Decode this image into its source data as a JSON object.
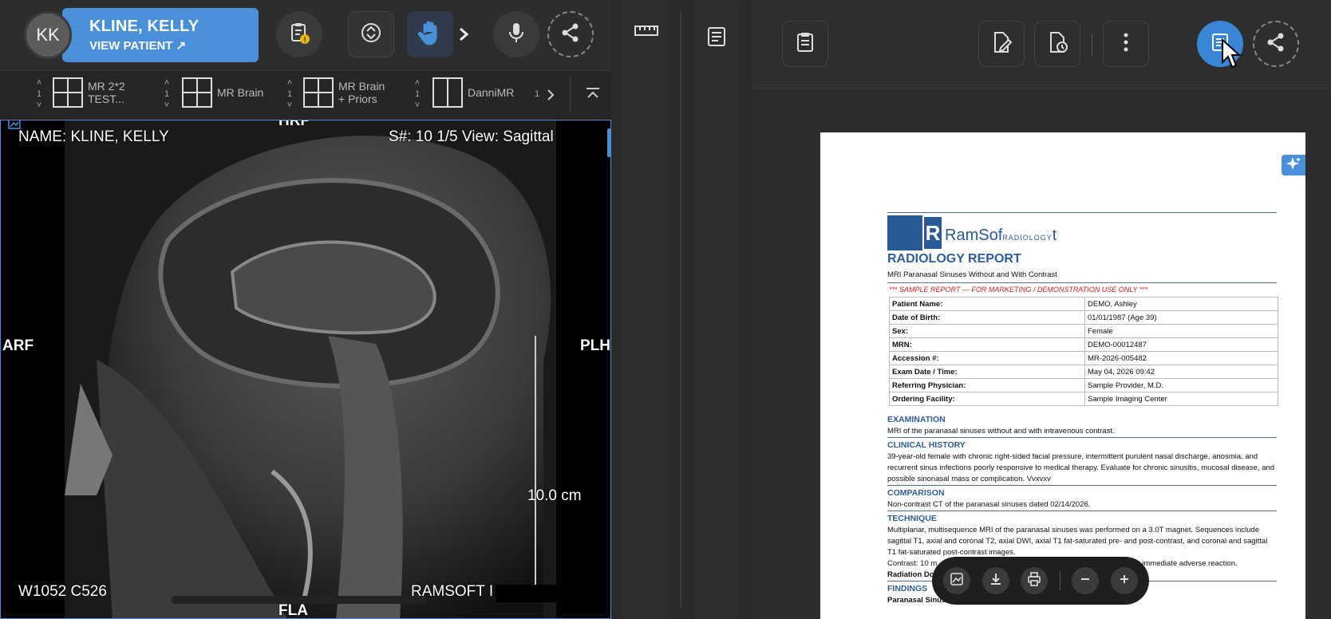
{
  "patient": {
    "initials": "KK",
    "name": "KLINE, KELLY",
    "view_patient_label": "VIEW PATIENT ↗"
  },
  "layouts": [
    {
      "count": "1",
      "label_line1": "MR 2*2",
      "label_line2": "TEST..."
    },
    {
      "count": "1",
      "label_line1": "MR Brain",
      "label_line2": ""
    },
    {
      "count": "1",
      "label_line1": "MR Brain",
      "label_line2": "+ Priors"
    },
    {
      "count": "1",
      "label_line1": "DanniMR",
      "label_line2": ""
    },
    {
      "count": "1",
      "label_line1": "",
      "label_line2": ""
    }
  ],
  "viewport": {
    "name_overlay": "NAME: KLINE, KELLY",
    "series_overlay": "S#: 10  1/5  View: Sagittal",
    "orient_top": "HRP",
    "orient_left": "ARF",
    "orient_right": "PLH",
    "orient_bottom": "FLA",
    "scale_label": "10.0 cm",
    "window_level": "W1052 C526",
    "institution": "RAMSOFT I"
  },
  "report": {
    "logo_text": "RamSof",
    "logo_small": "RADIOLOGY",
    "logo_tail": "t",
    "title": "RADIOLOGY REPORT",
    "subtitle": "MRI Paranasal Sinuses Without and With Contrast",
    "sample_notice": "*** SAMPLE REPORT — FOR MARKETING / DEMONSTRATION USE ONLY ***",
    "fields": [
      {
        "k": "Patient Name:",
        "v": "DEMO, Ashley"
      },
      {
        "k": "Date of Birth:",
        "v": "01/01/1987 (Age 39)"
      },
      {
        "k": "Sex:",
        "v": "Female"
      },
      {
        "k": "MRN:",
        "v": "DEMO-00012487"
      },
      {
        "k": "Accession #:",
        "v": "MR-2026-005482"
      },
      {
        "k": "Exam Date / Time:",
        "v": "May 04, 2026  09:42"
      },
      {
        "k": "Referring Physician:",
        "v": "Sample Provider, M.D."
      },
      {
        "k": "Ordering Facility:",
        "v": "Sample Imaging Center"
      }
    ],
    "examination_head": "EXAMINATION",
    "examination_text": "MRI of the paranasal sinuses without and with intravenous contrast.",
    "history_head": "CLINICAL HISTORY",
    "history_text": "39-year-old female with chronic right-sided facial pressure, intermittent purulent nasal discharge, anosmia, and recurrent sinus infections poorly responsive to medical therapy. Evaluate for chronic sinusitis, mucosal disease, and possible sinonasal mass or complication. Vvxvxv",
    "comparison_head": "COMPARISON",
    "comparison_text": "Non-contrast CT of the paranasal sinuses dated 02/14/2026.",
    "technique_head": "TECHNIQUE",
    "technique_text": "Multiplanar, multisequence MRI of the paranasal sinuses was performed on a 3.0T magnet. Sequences include sagittal T1, axial and coronal T2, axial DWI, axial T1 fat-saturated pre- and post-contrast, and coronal and sagittal T1 fat-saturated post-contrast images.",
    "contrast_text": "Contrast: 10 m",
    "contrast_tail": "t immediate adverse reaction.",
    "radiation_text": "Radiation Do",
    "findings_head": "FINDINGS",
    "findings_sub": "Paranasal Sinuses:"
  },
  "colors": {
    "accent": "#4a90d9",
    "report_heading": "#2e5e9a",
    "sample_red": "#d42020"
  }
}
